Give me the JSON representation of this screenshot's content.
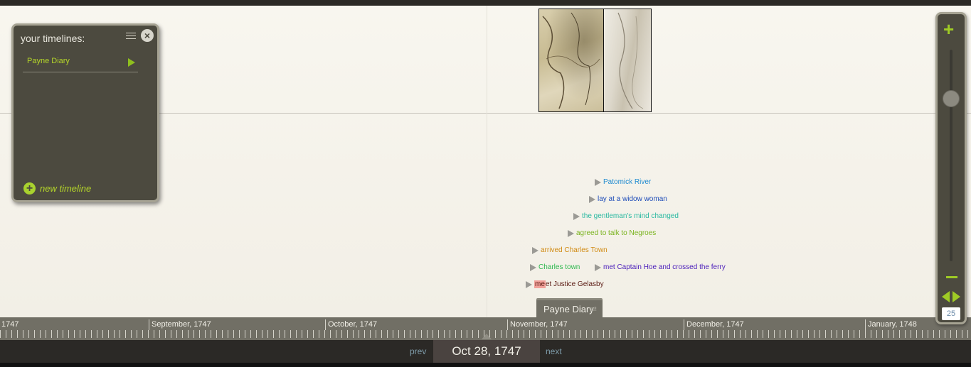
{
  "panel": {
    "title": "your timelines:",
    "menu_icon": "menu-icon",
    "close_icon": "close-icon",
    "items": [
      {
        "label": "Payne Diary",
        "icon": "play-icon"
      }
    ],
    "new_timeline_label": "new timeline",
    "new_timeline_icon": "plus-circle-icon"
  },
  "images": [
    {
      "name": "map-thumbnail-1",
      "desc": "antique map"
    },
    {
      "name": "map-thumbnail-2",
      "desc": "antique map"
    }
  ],
  "events": [
    {
      "label": "Patomick River",
      "color": "#1d8ad0"
    },
    {
      "label": "lay at a widow woman",
      "color": "#1c4bb8"
    },
    {
      "label": "the gentleman's mind changed",
      "color": "#27b8a0"
    },
    {
      "label": "agreed to talk to Negroes",
      "color": "#7ab31d"
    },
    {
      "label": "arrived Charles Town",
      "color": "#d18a12"
    },
    {
      "label": "Charles town",
      "color": "#2eb84f"
    },
    {
      "label": "met Captain Hoe and crossed the ferry",
      "color": "#4a1dbb"
    },
    {
      "label": "meet Justice Gelasby",
      "highlight": "me",
      "rest": "et Justice Gelasby",
      "color": "#5a1a12"
    }
  ],
  "timeline_label": "Payne Diary",
  "ruler": {
    "months": [
      "1747",
      "September, 1747",
      "October, 1747",
      "November, 1747",
      "December, 1747",
      "January, 1748"
    ]
  },
  "nav": {
    "prev": "prev",
    "next": "next",
    "current_date": "Oct 28, 1747"
  },
  "zoom": {
    "zoom_in_icon": "plus-icon",
    "zoom_out_icon": "minus-icon",
    "level": "25",
    "slider_fraction": 0.26
  },
  "colors": {
    "accent": "#9fcb25",
    "panel": "#4c4a3f",
    "ruler": "#716f65"
  }
}
